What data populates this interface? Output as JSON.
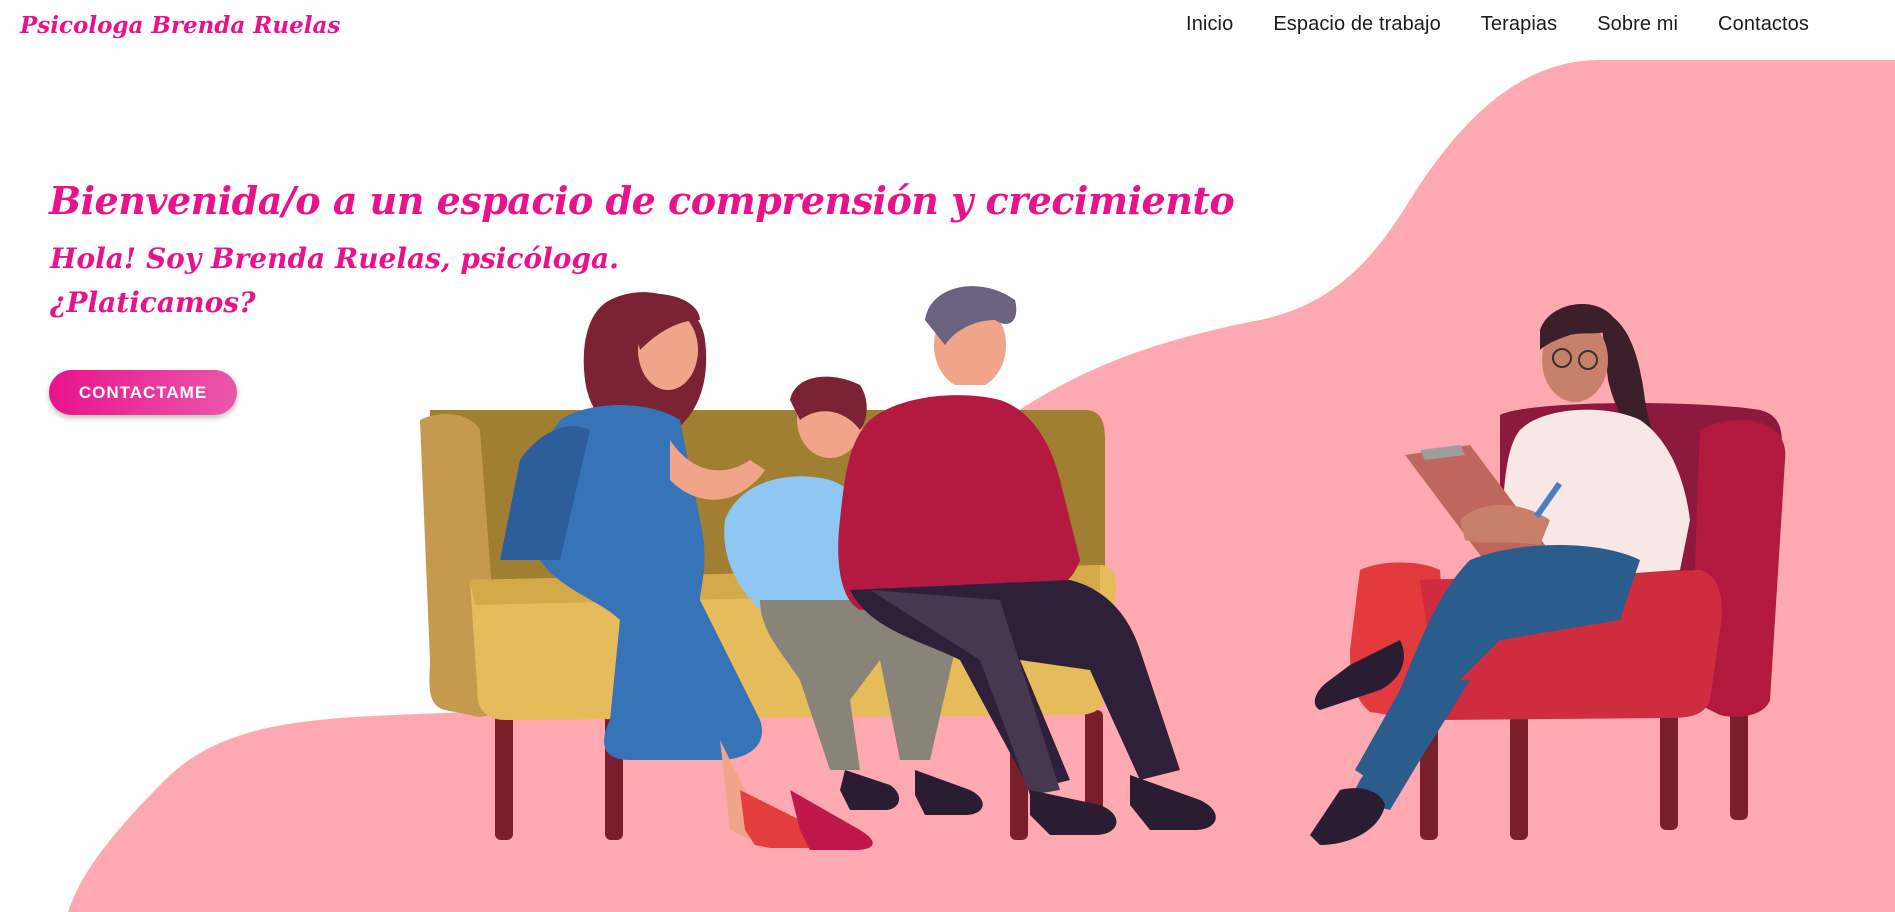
{
  "brand": {
    "name": "Psicologa Brenda Ruelas"
  },
  "nav": {
    "items": [
      {
        "label": "Inicio"
      },
      {
        "label": "Espacio de trabajo"
      },
      {
        "label": "Terapias"
      },
      {
        "label": "Sobre mi"
      },
      {
        "label": "Contactos"
      }
    ]
  },
  "hero": {
    "title": "Bienvenida/o a un espacio de comprensión y crecimiento",
    "subtitle_line1": "Hola! Soy Brenda Ruelas, psicóloga.",
    "subtitle_line2": "¿Platicamos?",
    "cta_label": "CONTACTAME"
  },
  "colors": {
    "accent": "#e8138c",
    "background_blob": "#fea9b2",
    "nav_text": "#1c1c1c"
  },
  "illustration": {
    "icon": "therapy-session-illustration"
  }
}
